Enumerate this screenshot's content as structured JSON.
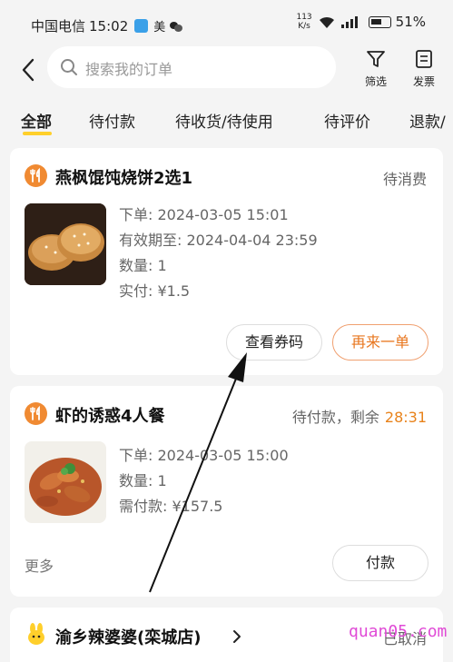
{
  "status_bar": {
    "carrier": "中国电信",
    "time": "15:02",
    "extra": "美",
    "net_speed_value": "113",
    "net_speed_unit": "K/s",
    "battery": "51%"
  },
  "header": {
    "search_placeholder": "搜索我的订单",
    "filter_label": "筛选",
    "invoice_label": "发票"
  },
  "tabs": [
    {
      "label": "全部",
      "active": true
    },
    {
      "label": "待付款"
    },
    {
      "label": "待收货/待使用"
    },
    {
      "label": "待评价"
    },
    {
      "label": "退款/"
    }
  ],
  "orders": [
    {
      "shop": "燕枫馄饨烧饼2选1",
      "status": "待消费",
      "lines": [
        "下单: 2024-03-05 15:01",
        "有效期至: 2024-04-04 23:59",
        "数量: 1",
        "实付: ¥1.5"
      ],
      "buttons": [
        "查看券码",
        "再来一单"
      ]
    },
    {
      "shop": "虾的诱惑4人餐",
      "status": "待付款，剩余",
      "timer": "28:31",
      "lines": [
        "下单: 2024-03-05 15:00",
        "数量: 1",
        "需付款: ¥157.5"
      ],
      "more": "更多",
      "buttons": [
        "付款"
      ]
    },
    {
      "shop": "渝乡辣婆婆(栾城店)",
      "status": "已取消"
    }
  ],
  "watermark": "quan05.com",
  "colors": {
    "accent_yellow": "#ffcf2b",
    "accent_orange": "#e8761e",
    "shop_icon_orange": "#f08a32"
  }
}
